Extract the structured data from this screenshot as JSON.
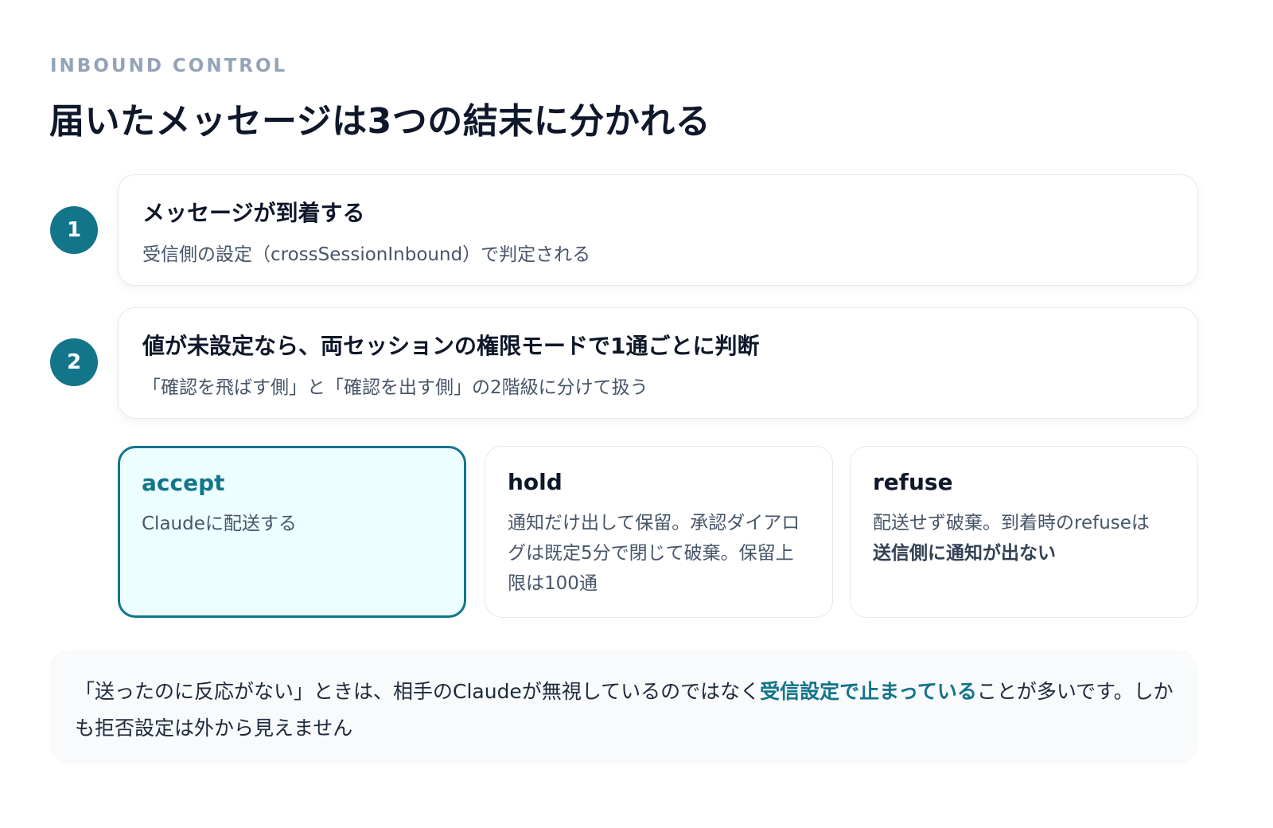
{
  "header": {
    "eyebrow": "INBOUND CONTROL",
    "title": "届いたメッセージは3つの結末に分かれる"
  },
  "steps": [
    {
      "number": "1",
      "title": "メッセージが到着する",
      "description": "受信側の設定（crossSessionInbound）で判定される"
    },
    {
      "number": "2",
      "title": "値が未設定なら、両セッションの権限モードで1通ごとに判断",
      "description": "「確認を飛ばす側」と「確認を出す側」の2階級に分けて扱う"
    }
  ],
  "outcomes": [
    {
      "name": "accept",
      "description": "Claudeに配送する",
      "selected": true
    },
    {
      "name": "hold",
      "description": "通知だけ出して保留。承認ダイアログは既定5分で閉じて破棄。保留上限は100通",
      "selected": false
    },
    {
      "name": "refuse",
      "description_prefix": "配送せず破棄。到着時のrefuseは",
      "description_bold": "送信側に通知が出ない",
      "selected": false
    }
  ],
  "note": {
    "prefix": "「送ったのに反応がない」ときは、相手のClaudeが無視しているのではなく",
    "highlight": "受信設定で止まっている",
    "suffix": "ことが多いです。しかも拒否設定は外から見えません"
  },
  "colors": {
    "accent": "#13758a",
    "accent_bg": "#ecfeff",
    "eyebrow": "#94a3b8",
    "note_bg": "#f8fafc"
  }
}
